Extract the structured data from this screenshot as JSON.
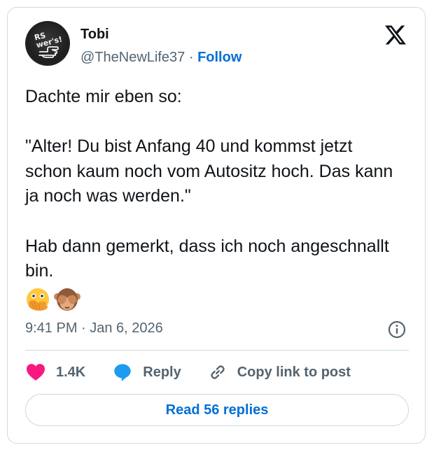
{
  "author": {
    "name": "Tobi",
    "handle": "@TheNewLife37",
    "separator": " · ",
    "follow_label": "Follow",
    "avatar_shirt_text": "RS\nwer's!"
  },
  "brand": {
    "logo_icon": "x-logo-icon"
  },
  "tweet": {
    "text": "Dachte mir eben so:\n\n\"Alter! Du bist Anfang 40 und kommst jetzt schon kaum noch vom Autositz hoch. Das kann ja noch was werden.\"\n\nHab dann gemerkt, dass ich noch angeschnallt bin.",
    "emojis": [
      "face-with-open-eyes-and-hand-over-mouth",
      "see-no-evil-monkey"
    ],
    "timestamp": "9:41 PM · Jan 6, 2026"
  },
  "actions": {
    "likes_count": "1.4K",
    "reply_label": "Reply",
    "copy_link_label": "Copy link to post"
  },
  "read_replies_label": "Read 56 replies",
  "colors": {
    "link_blue": "#006fd6",
    "like_pink": "#f91880",
    "reply_blue": "#1d9bf0",
    "muted_text": "#536471",
    "border": "#cfd9de"
  }
}
